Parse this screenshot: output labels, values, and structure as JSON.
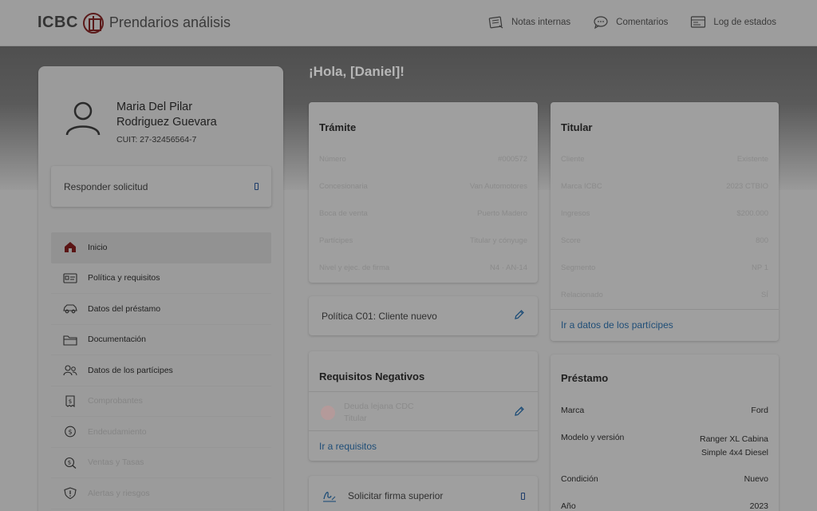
{
  "header": {
    "brand_short": "ICBC",
    "app_title": "Prendarios análisis",
    "nav": [
      {
        "label": "Notas internas",
        "icon": "notes-icon"
      },
      {
        "label": "Comentarios",
        "icon": "comments-icon"
      },
      {
        "label": "Log de estados",
        "icon": "log-icon"
      }
    ]
  },
  "greeting": "¡Hola, [Daniel]!",
  "profile": {
    "name_line1": "Maria Del Pilar",
    "name_line2": "Rodriguez Guevara",
    "cuit": "CUIT: 27-32456564-7"
  },
  "respond_label": "Responder solicitud",
  "menu": [
    {
      "label": "Inicio",
      "icon": "home-icon",
      "active": true,
      "disabled": false
    },
    {
      "label": "Política y requisitos",
      "icon": "id-card-icon",
      "active": false,
      "disabled": false
    },
    {
      "label": "Datos del préstamo",
      "icon": "car-icon",
      "active": false,
      "disabled": false
    },
    {
      "label": "Documentación",
      "icon": "folder-icon",
      "active": false,
      "disabled": false
    },
    {
      "label": "Datos de los partícipes",
      "icon": "people-icon",
      "active": false,
      "disabled": false
    },
    {
      "label": "Comprobantes",
      "icon": "receipt-icon",
      "active": false,
      "disabled": true
    },
    {
      "label": "Endeudamiento",
      "icon": "debt-icon",
      "active": false,
      "disabled": true
    },
    {
      "label": "Ventas y Tasas",
      "icon": "rates-icon",
      "active": false,
      "disabled": true
    },
    {
      "label": "Alertas y riesgos",
      "icon": "shield-icon",
      "active": false,
      "disabled": true
    }
  ],
  "tramite": {
    "title": "Trámite",
    "rows": [
      {
        "label": "Número",
        "value": "#000572"
      },
      {
        "label": "Concesionaria",
        "value": "Van Automotores"
      },
      {
        "label": "Boca de venta",
        "value": "Puerto Madero"
      },
      {
        "label": "Partícipes",
        "value": "Titular y cónyuge"
      },
      {
        "label": "Nivel y ejec. de firma",
        "value": "N4 · AN-14"
      }
    ]
  },
  "titular": {
    "title": "Titular",
    "rows": [
      {
        "label": "Cliente",
        "value": "Existente"
      },
      {
        "label": "Marca ICBC",
        "value": "2023 CTBIO"
      },
      {
        "label": "Ingresos",
        "value": "$200.000"
      },
      {
        "label": "Score",
        "value": "800"
      },
      {
        "label": "Segmento",
        "value": "NP 1"
      },
      {
        "label": "Relacionado",
        "value": "SÍ"
      }
    ],
    "link": "Ir a datos de los partícipes"
  },
  "politica_label": "Política C01: Cliente nuevo",
  "requisitos": {
    "title": "Requisitos Negativos",
    "item_line1": "Deuda lejana CDC",
    "item_line2": "Titular",
    "link": "Ir a requisitos"
  },
  "firma_label": "Solicitar firma superior",
  "prestamo": {
    "title": "Préstamo",
    "rows": [
      {
        "label": "Marca",
        "value": "Ford"
      },
      {
        "label": "Modelo y versión",
        "value": "Ranger XL Cabina",
        "value2": "Simple 4x4 Diesel"
      },
      {
        "label": "Condición",
        "value": "Nuevo"
      },
      {
        "label": "Año",
        "value": "2023"
      }
    ]
  },
  "colors": {
    "accent": "#1f4e78",
    "brand": "#5b1a1a",
    "home_icon": "#5b1515"
  }
}
